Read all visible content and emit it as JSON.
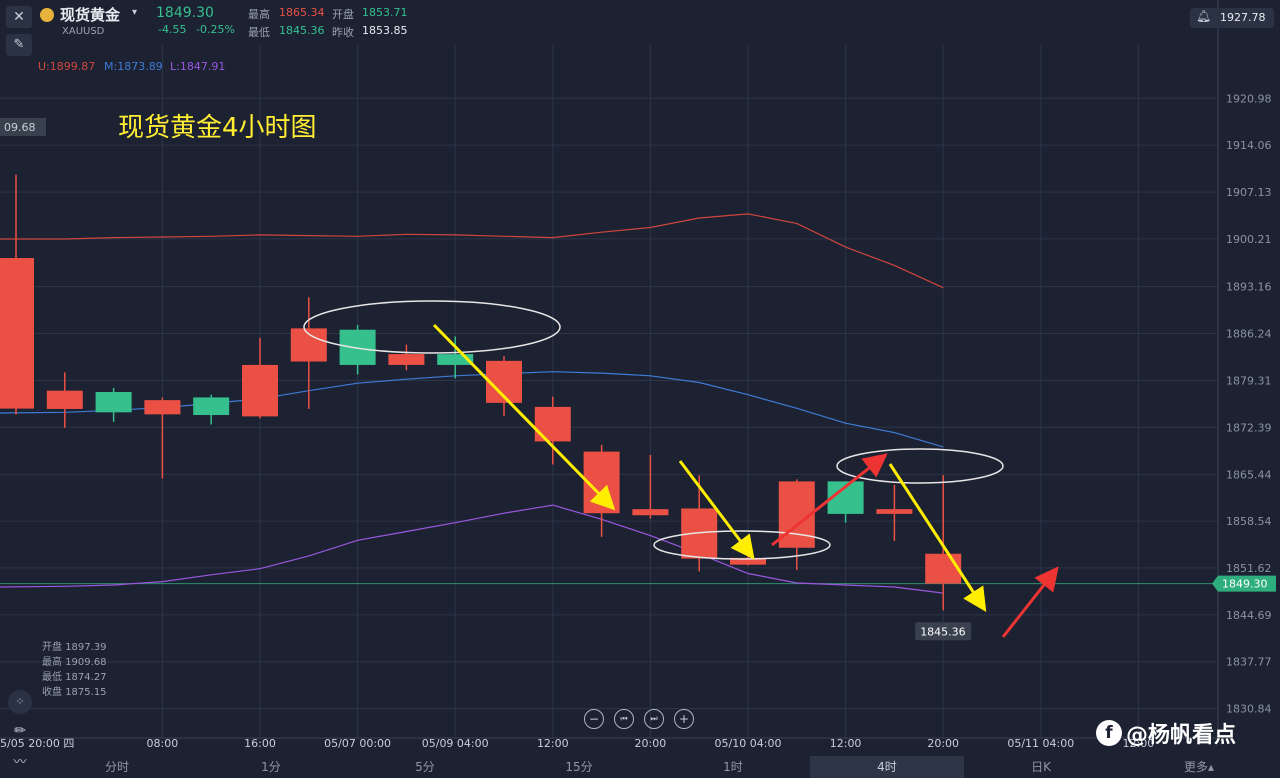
{
  "header": {
    "name": "现货黄金",
    "symbol": "XAUUSD",
    "price": "1849.30",
    "change": "-4.55",
    "change_pct": "-0.25%",
    "high_label": "最高",
    "high": "1865.34",
    "open_label": "开盘",
    "open": "1853.71",
    "low_label": "最低",
    "low": "1845.36",
    "prev_label": "昨收",
    "prev": "1853.85",
    "alert_value": "1927.78"
  },
  "indicator": {
    "u": "U:1899.87",
    "m": "M:1873.89",
    "l": "L:1847.91"
  },
  "ohlc_panel": {
    "rows": [
      {
        "label": "开盘",
        "value": "1897.39"
      },
      {
        "label": "最高",
        "value": "1909.68"
      },
      {
        "label": "最低",
        "value": "1874.27"
      },
      {
        "label": "收盘",
        "value": "1875.15"
      }
    ]
  },
  "colors": {
    "up": "#35c08e",
    "down": "#eb5044",
    "upper": "#d0463d",
    "middle": "#3e7bd6",
    "lower": "#9a57e0",
    "bg": "#1c2232",
    "arrow_yellow": "#ffee00",
    "arrow_red": "#ee3333"
  },
  "watermark": "@杨帆看点",
  "controls": [
    "zoom-out",
    "prev",
    "next",
    "zoom-in"
  ],
  "timeframes": {
    "items": [
      "分时",
      "1分",
      "5分",
      "15分",
      "1时",
      "4时",
      "日K",
      "更多▴"
    ],
    "active": "4时"
  },
  "chart_data": {
    "type": "candlestick",
    "title": "现货黄金4小时图",
    "ylim": [
      1826.5,
      1929.0
    ],
    "y_ticks": [
      "1920.98",
      "1914.06",
      "1907.13",
      "1900.21",
      "1893.16",
      "1886.24",
      "1879.31",
      "1872.39",
      "1865.44",
      "1858.54",
      "1851.62",
      "1844.69",
      "1837.77",
      "1830.84"
    ],
    "x_ticks": [
      "5/05 20:00 四",
      "08:00",
      "16:00",
      "05/07 00:00",
      "05/09 04:00",
      "12:00",
      "20:00",
      "05/10 04:00",
      "12:00",
      "20:00",
      "05/11 04:00",
      "12:00"
    ],
    "x_tick_slots": [
      0,
      3,
      5,
      7,
      9,
      11,
      13,
      15,
      17,
      19,
      21,
      23
    ],
    "current_price": "1849.30",
    "last_low_label": "1845.36",
    "left_value_label": "09.68",
    "candles": [
      {
        "o": 1897.39,
        "h": 1909.68,
        "l": 1874.27,
        "c": 1875.15
      },
      {
        "o": 1877.8,
        "h": 1880.5,
        "l": 1872.3,
        "c": 1875.1
      },
      {
        "o": 1874.6,
        "h": 1878.2,
        "l": 1873.2,
        "c": 1877.6
      },
      {
        "o": 1876.4,
        "h": 1876.8,
        "l": 1864.8,
        "c": 1874.3
      },
      {
        "o": 1874.2,
        "h": 1877.2,
        "l": 1872.8,
        "c": 1876.8
      },
      {
        "o": 1881.6,
        "h": 1885.6,
        "l": 1873.7,
        "c": 1874.0
      },
      {
        "o": 1887.0,
        "h": 1891.6,
        "l": 1875.1,
        "c": 1882.1
      },
      {
        "o": 1881.6,
        "h": 1887.5,
        "l": 1880.2,
        "c": 1886.8
      },
      {
        "o": 1883.2,
        "h": 1884.6,
        "l": 1880.8,
        "c": 1881.6
      },
      {
        "o": 1881.6,
        "h": 1885.8,
        "l": 1879.6,
        "c": 1883.2
      },
      {
        "o": 1882.2,
        "h": 1882.9,
        "l": 1874.1,
        "c": 1876.0
      },
      {
        "o": 1875.4,
        "h": 1876.9,
        "l": 1866.9,
        "c": 1870.3
      },
      {
        "o": 1868.8,
        "h": 1869.8,
        "l": 1856.2,
        "c": 1859.7
      },
      {
        "o": 1860.3,
        "h": 1868.3,
        "l": 1858.9,
        "c": 1859.4
      },
      {
        "o": 1860.4,
        "h": 1865.3,
        "l": 1851.1,
        "c": 1853.0
      },
      {
        "o": 1853.1,
        "h": 1853.5,
        "l": 1852.0,
        "c": 1852.1
      },
      {
        "o": 1864.4,
        "h": 1864.7,
        "l": 1851.3,
        "c": 1854.6
      },
      {
        "o": 1859.6,
        "h": 1864.4,
        "l": 1858.3,
        "c": 1864.4
      },
      {
        "o": 1860.3,
        "h": 1863.9,
        "l": 1855.6,
        "c": 1859.6
      },
      {
        "o": 1853.71,
        "h": 1865.34,
        "l": 1845.36,
        "c": 1849.3
      }
    ],
    "series": [
      {
        "name": "U",
        "values": [
          1900.2,
          1900.2,
          1900.4,
          1900.5,
          1900.6,
          1900.8,
          1900.7,
          1900.6,
          1900.9,
          1900.8,
          1900.6,
          1900.4,
          1901.2,
          1901.9,
          1903.3,
          1903.9,
          1902.5,
          1899.0,
          1896.3,
          1893.0
        ]
      },
      {
        "name": "M",
        "values": [
          1874.5,
          1874.6,
          1874.9,
          1875.3,
          1875.9,
          1876.6,
          1877.8,
          1878.9,
          1879.5,
          1880.0,
          1880.3,
          1880.6,
          1880.4,
          1880.0,
          1879.0,
          1877.2,
          1875.2,
          1873.0,
          1871.6,
          1869.5
        ]
      },
      {
        "name": "L",
        "values": [
          1848.8,
          1848.9,
          1849.1,
          1849.6,
          1850.6,
          1851.5,
          1853.4,
          1855.7,
          1857.0,
          1858.3,
          1859.7,
          1860.9,
          1858.8,
          1856.4,
          1853.7,
          1850.8,
          1849.4,
          1849.1,
          1848.8,
          1847.9
        ]
      }
    ]
  }
}
